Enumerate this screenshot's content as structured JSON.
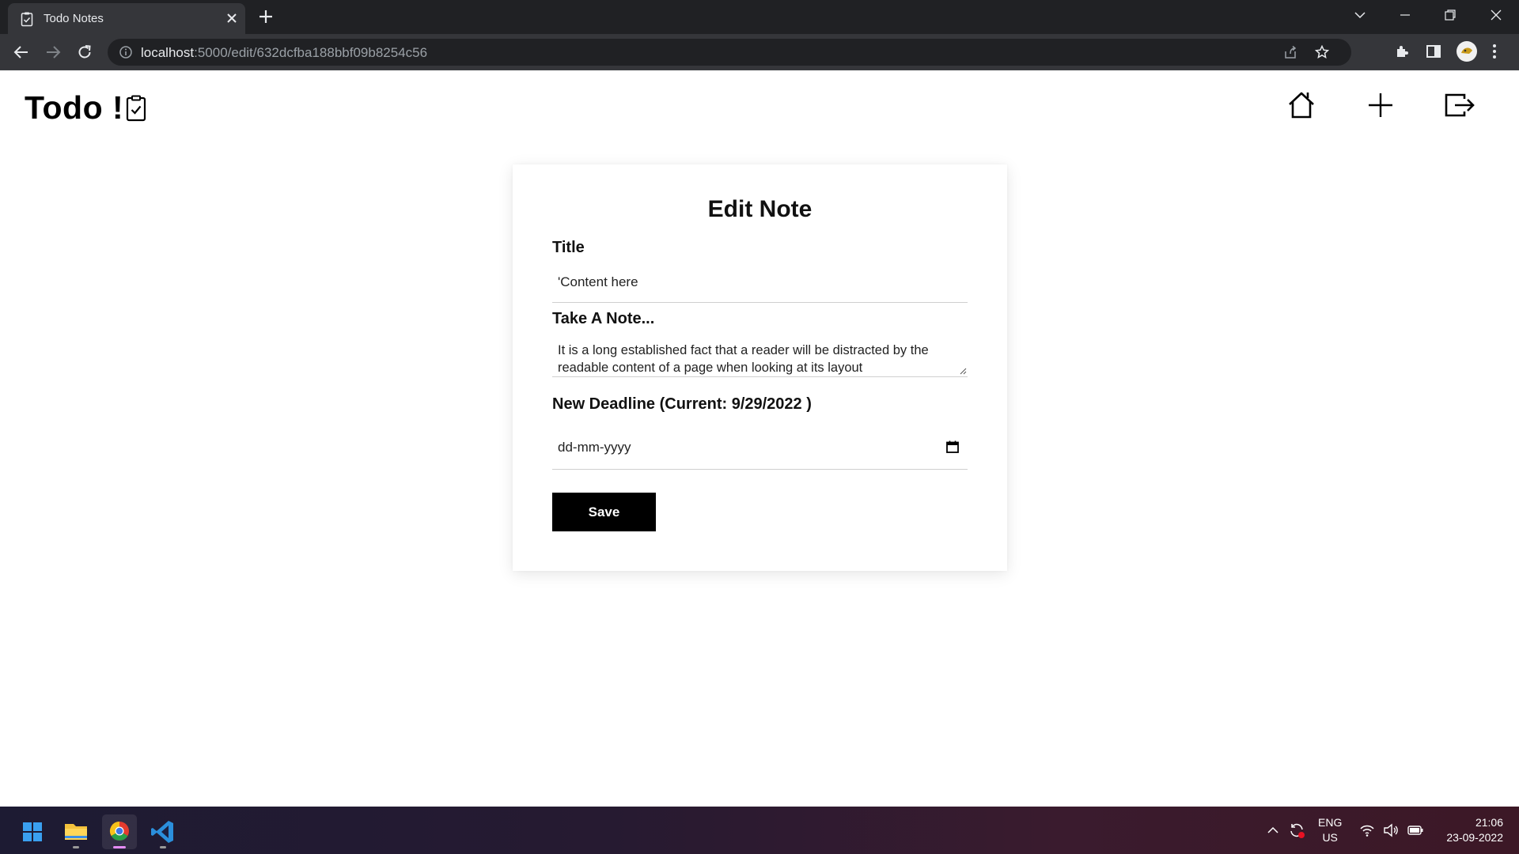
{
  "browser": {
    "tab_title": "Todo Notes",
    "url_host": "localhost",
    "url_path": ":5000/edit/632dcfba188bbf09b8254c56"
  },
  "header": {
    "brand": "Todo !",
    "nav": [
      "home-icon",
      "add-note-icon",
      "logout-icon"
    ]
  },
  "form": {
    "heading": "Edit Note",
    "title_label": "Title",
    "title_value": "'Content here",
    "note_label": "Take A Note...",
    "note_value": "It is a long established fact that a reader will be distracted by the readable content of a page when looking at its layout",
    "deadline_label": "New Deadline (Current: 9/29/2022 )",
    "deadline_placeholder": "dd-mm-yyyy",
    "save_label": "Save"
  },
  "taskbar": {
    "lang_top": "ENG",
    "lang_bottom": "US",
    "time": "21:06",
    "date": "23-09-2022"
  }
}
